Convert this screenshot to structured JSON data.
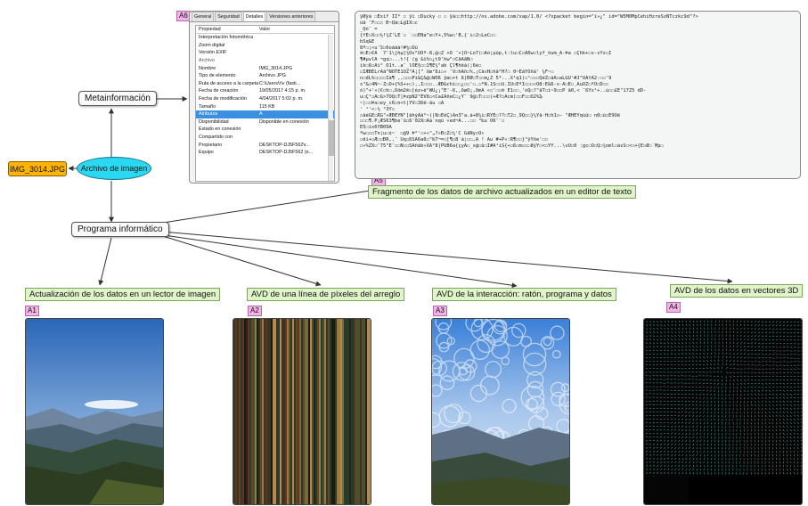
{
  "diagram": {
    "file_node": "IMG_3014.JPG",
    "center_node": "Archivo de imagen",
    "meta_node": "Metainformación",
    "program_node": "Programa informático",
    "caption_a5": "Fragmento de los datos de archivo actualizados en un editor de texto",
    "tags": {
      "a1": "A1",
      "a2": "A2",
      "a3": "A3",
      "a4": "A4",
      "a5": "A5",
      "a6": "A6"
    },
    "captions": {
      "a1": "Actualización de los datos en un lector de imagen",
      "a2": "AVD de una línea de píxeles del arreglo",
      "a3": "AVD de la interacción: ratón, programa y datos",
      "a4": "AVD de los datos en vectores 3D"
    }
  },
  "properties_dialog": {
    "tabs": [
      "General",
      "Seguridad",
      "Detalles",
      "Versiones anteriores"
    ],
    "col_property": "Propiedad",
    "col_value": "Valor",
    "rows": [
      {
        "k": "Interpretación fotométrica",
        "v": ""
      },
      {
        "k": "Zoom digital",
        "v": ""
      },
      {
        "k": "Versión EXIF",
        "v": ""
      }
    ],
    "group": "Archivo",
    "file_rows": [
      {
        "k": "Nombre",
        "v": "IMG_3014.JPG"
      },
      {
        "k": "Tipo de elemento",
        "v": "Archivo JPG"
      },
      {
        "k": "Ruta de acceso a la carpeta",
        "v": "C:\\Users\\r\\v (fasti..."
      },
      {
        "k": "Fecha de creación",
        "v": "19/05/2017 4:15 p. m."
      },
      {
        "k": "Fecha de modificación",
        "v": "4/04/2017 5:02 p. m."
      },
      {
        "k": "Tamaño",
        "v": "115 KB"
      },
      {
        "k": "Atributos",
        "v": "A"
      },
      {
        "k": "Disponibilidad",
        "v": "Disponible en conexión"
      },
      {
        "k": "Estado en conexión",
        "v": ""
      },
      {
        "k": "Compartido con",
        "v": ""
      },
      {
        "k": "Propietario",
        "v": "DESKTOP-DJ5F562\\r..."
      },
      {
        "k": "Equipo",
        "v": "DESKTOP-DJ5F562 (e..."
      }
    ]
  },
  "hex_editor": {
    "lines": [
      "ÿØÿá ☐Exif  II* ☐          ÿì ☐Ducky ☐ ☐   ÿá☐☐http://ns.adobe.com/xap/1.0/ <?xpacket begin=\"ï»¿\" id=\"W5M0MpCehiHzreSzNTczkc9d\"?>",
      "üä ¨F☐☐☐ Ð~Qã☐L@IX☐c",
      "  _Qn¨ =",
      "{fÉ☐X☐☐½!¾Z'LE´☐ ´☐☐ËÑa^e☐Ÿ+,5%w☐'B,{`i☐2☐LeC☐☐",
      "bSq&E",
      "8º☐¦«u'Š☐6oàäà!#¾☐Ôù",
      "®☐Ë☐€Â `7'1\\jhµ[¾Õv\"ÙÔª-8,@☐Ž +Ö ¨+]Ö~Lo7(☐Àó¦µúp,t:lu☐C☐Åßw☐lyf_õum_Ä-Þa ☐Çhk+☐s-sYs☐I",
      "   ¶#µvlÄ ¬g¢☐...t!{ (g &ì%☐¿t9'hw\"☐CåÃåN☐",
      "ìk☐ß☐Àì°   Õ1t..a¨_lÒÉ§☐☐1¶È¾\"ab Çl¶hêà(¦6é☐",
      "☐IÆÐÈLrAä^ÑOTE1ÔZ\"Ä¦[\"   Ùø²ßi☐«   ¯V☐hÄñ☐%,¡Cã¤H☐hä°H?☐ 0~ÈáÝÒñä' ¼F~☐",
      "n☐dL%☐☐☐☐Ìã¶ ,,☐☐☐Pì&Ç&@☐WÖß ÿæ☐+t ß|ÐØ☐T☐☐m¿Ž 5*...X¹q1(☐¹☐☐☐QéŽ☐ãÃ☐aLGÜ'#J^ÕÄ†Â2-☐☐'9",
      "s\"&☐4Ñ~-Ž☐Ö+{%Š+÷☐),,I☐☐☐..ÆÐ&chì☐☐¿☐☐'☐.☐*N.1S☐☐Ù.ÌÜ☐ÊºÏ☐☐☐«O8:Ê&6-x-Ã☐Ë☐¸AuÔZ☐ºÕ☐D☐☐",
      "ó)^+'«(€☐h☐,ßôm2®☐[éz÷ê\"WU¿¡\"É'-ß,,ðøÔ¡,ðmÄ «☐'☐☐®     È1☐☐¸'óQ☐?\"ãT☐i~9☐☐P å0,< ¨ßÝx¹+..ù☐☐£Ë\"17Z5 dD-",
      "  u☐Ç¹☐Ã☐G>7ÔQ☐T|ÞzpN2\"ÉVß☐<Ca£ÅñeC☐¿Y¯`9@☐T☐☐☐(+Æ?☐Àcm)☐☐F☐☐Õ2%₯",
      "~|☐☐Þo☐ey_c6☐n<t|ÝV☐3ßë-ãu ☐Ã",
      "' ¹'<:½     °3Y☐",
      "☐ãéGE☐RG\"«ÆÐÊÝN\"[áhýÀã°~(|Ñ☐ÊêÇ)Àn3\"a.á+8¼ì☐RÝÉ☐??☐T2☐¸9Q☐☐}¼Ÿã·H☐h1☐— \"ÆHÉYqùü☐ n0☐ú☐E9Õë",
      "☐☐☐¶.P¡ÆS63¶be¯û☐ß'02X☐Åà`nqú       «ed¬Å...☐☐ ³‰u`Õ6¯¯☐",
      "È5☐ìx6YB09Â",
      "  ºw☐☐☐Tn¦u☐¢~`   ☐@9 Þ°'☐+«\"„?»Ð☐Ž☐¼'C GâÑy☐Ó«",
      "☐ëi+☐Æ☐☐ÐR,,¨ Uq☐ßSÀ6a6☐\"‰T¬=☐[¶☐8`á¦☐☐,A ! Ãu`#+P«:R¶☐☐}\"ÿÝöe'☐☐",
      "☐»%ŽX☐¨75\"E¯☐☐Ñ☐☐SÄñàb«XÀ²8|PÜB6a{çyÀ☐_x@☐û☐Ì#À¹ìŠ{+☐ß☐m☐☐☐8ÿÝ☐<☐ÝŸ...\\vÜ☐0 :gc☐Ö☐Q☐¾oml☐àsŠ☐<☐+{È☐Ø☐`Mp☐"
    ]
  },
  "colors": {
    "ellipse": "#29d9f1",
    "file_node": "#ffb400",
    "caption_bg": "#dff4c8",
    "tag_bg": "#f2b4e6",
    "selection": "#3b8fe0"
  }
}
